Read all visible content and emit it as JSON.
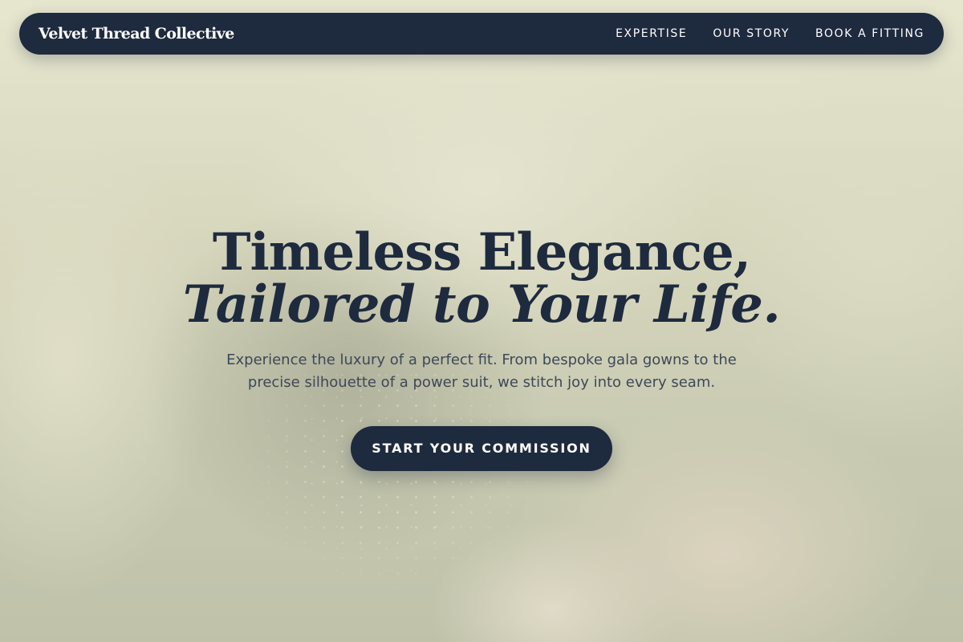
{
  "brand": {
    "name": "Velvet Thread Collective"
  },
  "nav": {
    "links": [
      {
        "label": "EXPERTISE"
      },
      {
        "label": "OUR STORY"
      },
      {
        "label": "BOOK A FITTING"
      }
    ]
  },
  "hero": {
    "headline_line1": "Timeless Elegance,",
    "headline_line2": "Tailored to Your Life.",
    "subtext": "Experience the luxury of a perfect fit. From bespoke gala gowns to the precise silhouette of a power suit, we stitch joy into every seam.",
    "cta_label": "START YOUR COMMISSION"
  },
  "colors": {
    "navy": "#1e2a3e",
    "body_text": "#3e4859",
    "white": "#ffffff"
  }
}
